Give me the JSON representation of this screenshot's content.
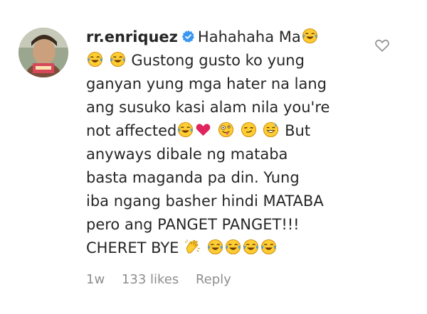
{
  "comment": {
    "username": "rr.enriquez",
    "verified": true,
    "avatar_icon": "profile-avatar",
    "text_lines": [
      "Hahahaha Ma",
      "Gustong gusto ko yung",
      "ganyan yung mga hater na lang",
      "ang susuko kasi alam nila you're",
      "not affected",
      "But",
      "anyways dibale ng mataba",
      "basta maganda pa din. Yung",
      "iba ngang basher hindi MATABA",
      "pero ang PANGET PANGET!!!",
      "CHERET BYE"
    ],
    "emojis": [
      "face-with-tears-of-joy",
      "red-heart",
      "zany-face",
      "smirking-face",
      "grinning-sweat-face",
      "clapping-hands"
    ],
    "like_icon": "heart-outline-icon",
    "meta": {
      "age": "1w",
      "likes": "133 likes",
      "reply_label": "Reply"
    }
  },
  "colors": {
    "text": "#262626",
    "muted": "#8e8e8e",
    "verified_blue": "#3897f0",
    "emoji_yellow": "#ffcc33",
    "tear_blue": "#4aa3e8",
    "heart_red": "#e0245e"
  }
}
